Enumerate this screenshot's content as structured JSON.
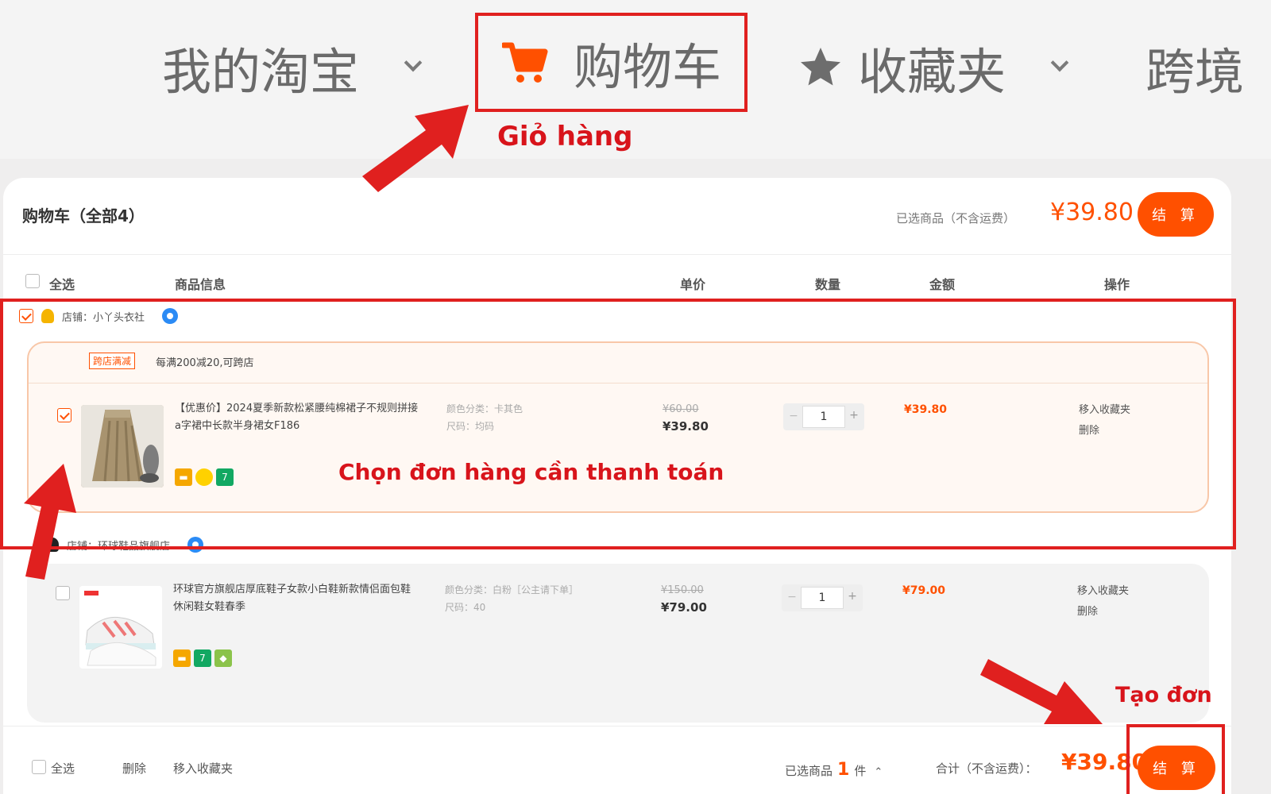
{
  "nav": {
    "my_taobao": "我的淘宝",
    "cart": "购物车",
    "favorites": "收藏夹",
    "cross_border": "跨境"
  },
  "annotations": {
    "cart_label": "Giỏ hàng",
    "choose_order": "Chọn đơn hàng cần thanh toán",
    "create_order": "Tạo đơn"
  },
  "cart": {
    "title": "购物车（全部4）",
    "selected_label": "已选商品（不含运费）",
    "selected_price": "¥39.80",
    "settle_button": "结 算",
    "columns": {
      "select_all": "全选",
      "product_info": "商品信息",
      "unit_price": "单价",
      "quantity": "数量",
      "amount": "金额",
      "operation": "操作"
    },
    "shops": [
      {
        "name": "店铺：小丫头衣社",
        "checked": true,
        "promo_tag": "跨店满减",
        "promo_text": "每满200减20,可跨店",
        "item": {
          "title": "【优惠价】2024夏季新款松紧腰纯棉裙子不规则拼接a字裙中长款半身裙女F186",
          "spec_color": "颜色分类：卡其色",
          "spec_size": "尺码：均码",
          "old_price": "¥60.00",
          "price": "¥39.80",
          "qty": "1",
          "amount": "¥39.80",
          "op_fav": "移入收藏夹",
          "op_delete": "删除",
          "checked": true
        }
      },
      {
        "name": "店铺：环球鞋品旗舰店",
        "checked": false,
        "item": {
          "title": "环球官方旗舰店厚底鞋子女款小白鞋新款情侣面包鞋休闲鞋女鞋春季",
          "spec_color": "颜色分类：白粉［公主请下单］",
          "spec_size": "尺码：40",
          "old_price": "¥150.00",
          "price": "¥79.00",
          "qty": "1",
          "amount": "¥79.00",
          "op_fav": "移入收藏夹",
          "op_delete": "删除",
          "checked": false
        }
      }
    ],
    "bottom": {
      "select_all": "全选",
      "delete": "删除",
      "move_fav": "移入收藏夹",
      "selected_prefix": "已选商品",
      "selected_count": "1",
      "selected_suffix": "件",
      "total_label": "合计（不含运费）：",
      "total_price": "¥39.80",
      "settle_button": "结 算"
    }
  },
  "colors": {
    "accent": "#ff5000",
    "annotation_red": "#e0201f"
  }
}
